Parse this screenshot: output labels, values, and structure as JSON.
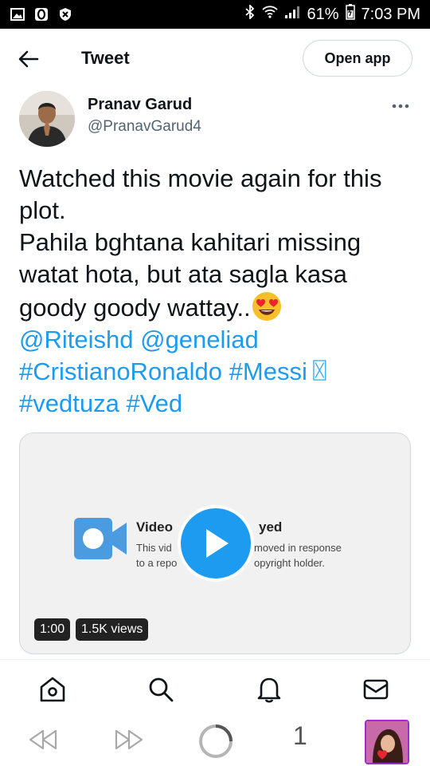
{
  "status_bar": {
    "battery": "61%",
    "time": "7:03 PM",
    "icons": [
      "image-icon",
      "o-icon",
      "shield-x-icon",
      "bluetooth-icon",
      "wifi-icon",
      "signal-icon",
      "battery-icon"
    ]
  },
  "header": {
    "title": "Tweet",
    "open_app_label": "Open app"
  },
  "author": {
    "name": "Pranav Garud",
    "handle": "@PranavGarud4"
  },
  "tweet": {
    "line1": "Watched this movie again for this plot.",
    "line2": "Pahila bghtana kahitari missing watat hota, but ata sagla kasa goody goody wattay..",
    "mention1": "@Riteishd",
    "mention2": "@geneliad",
    "hashtag1": "#CristianoRonaldo",
    "hashtag2": "#Messi",
    "hashtag2_suffix": "〿",
    "hashtag3": "#vedtuza",
    "hashtag4": "#Ved"
  },
  "media": {
    "unavailable_title_a": "Video",
    "unavailable_title_b": "yed",
    "unavailable_line1_a": "This vid",
    "unavailable_line1_b": "moved in response",
    "unavailable_line2_a": "to a repo",
    "unavailable_line2_b": "opyright holder.",
    "duration": "1:00",
    "views": "1.5K views"
  },
  "tab_bar": {
    "icons": [
      "home-icon",
      "search-icon",
      "notifications-icon",
      "messages-icon"
    ]
  },
  "browser_nav": {
    "tab_count": "1"
  },
  "colors": {
    "accent": "#1d9bf0",
    "text": "#0f1419",
    "secondary": "#536471"
  }
}
